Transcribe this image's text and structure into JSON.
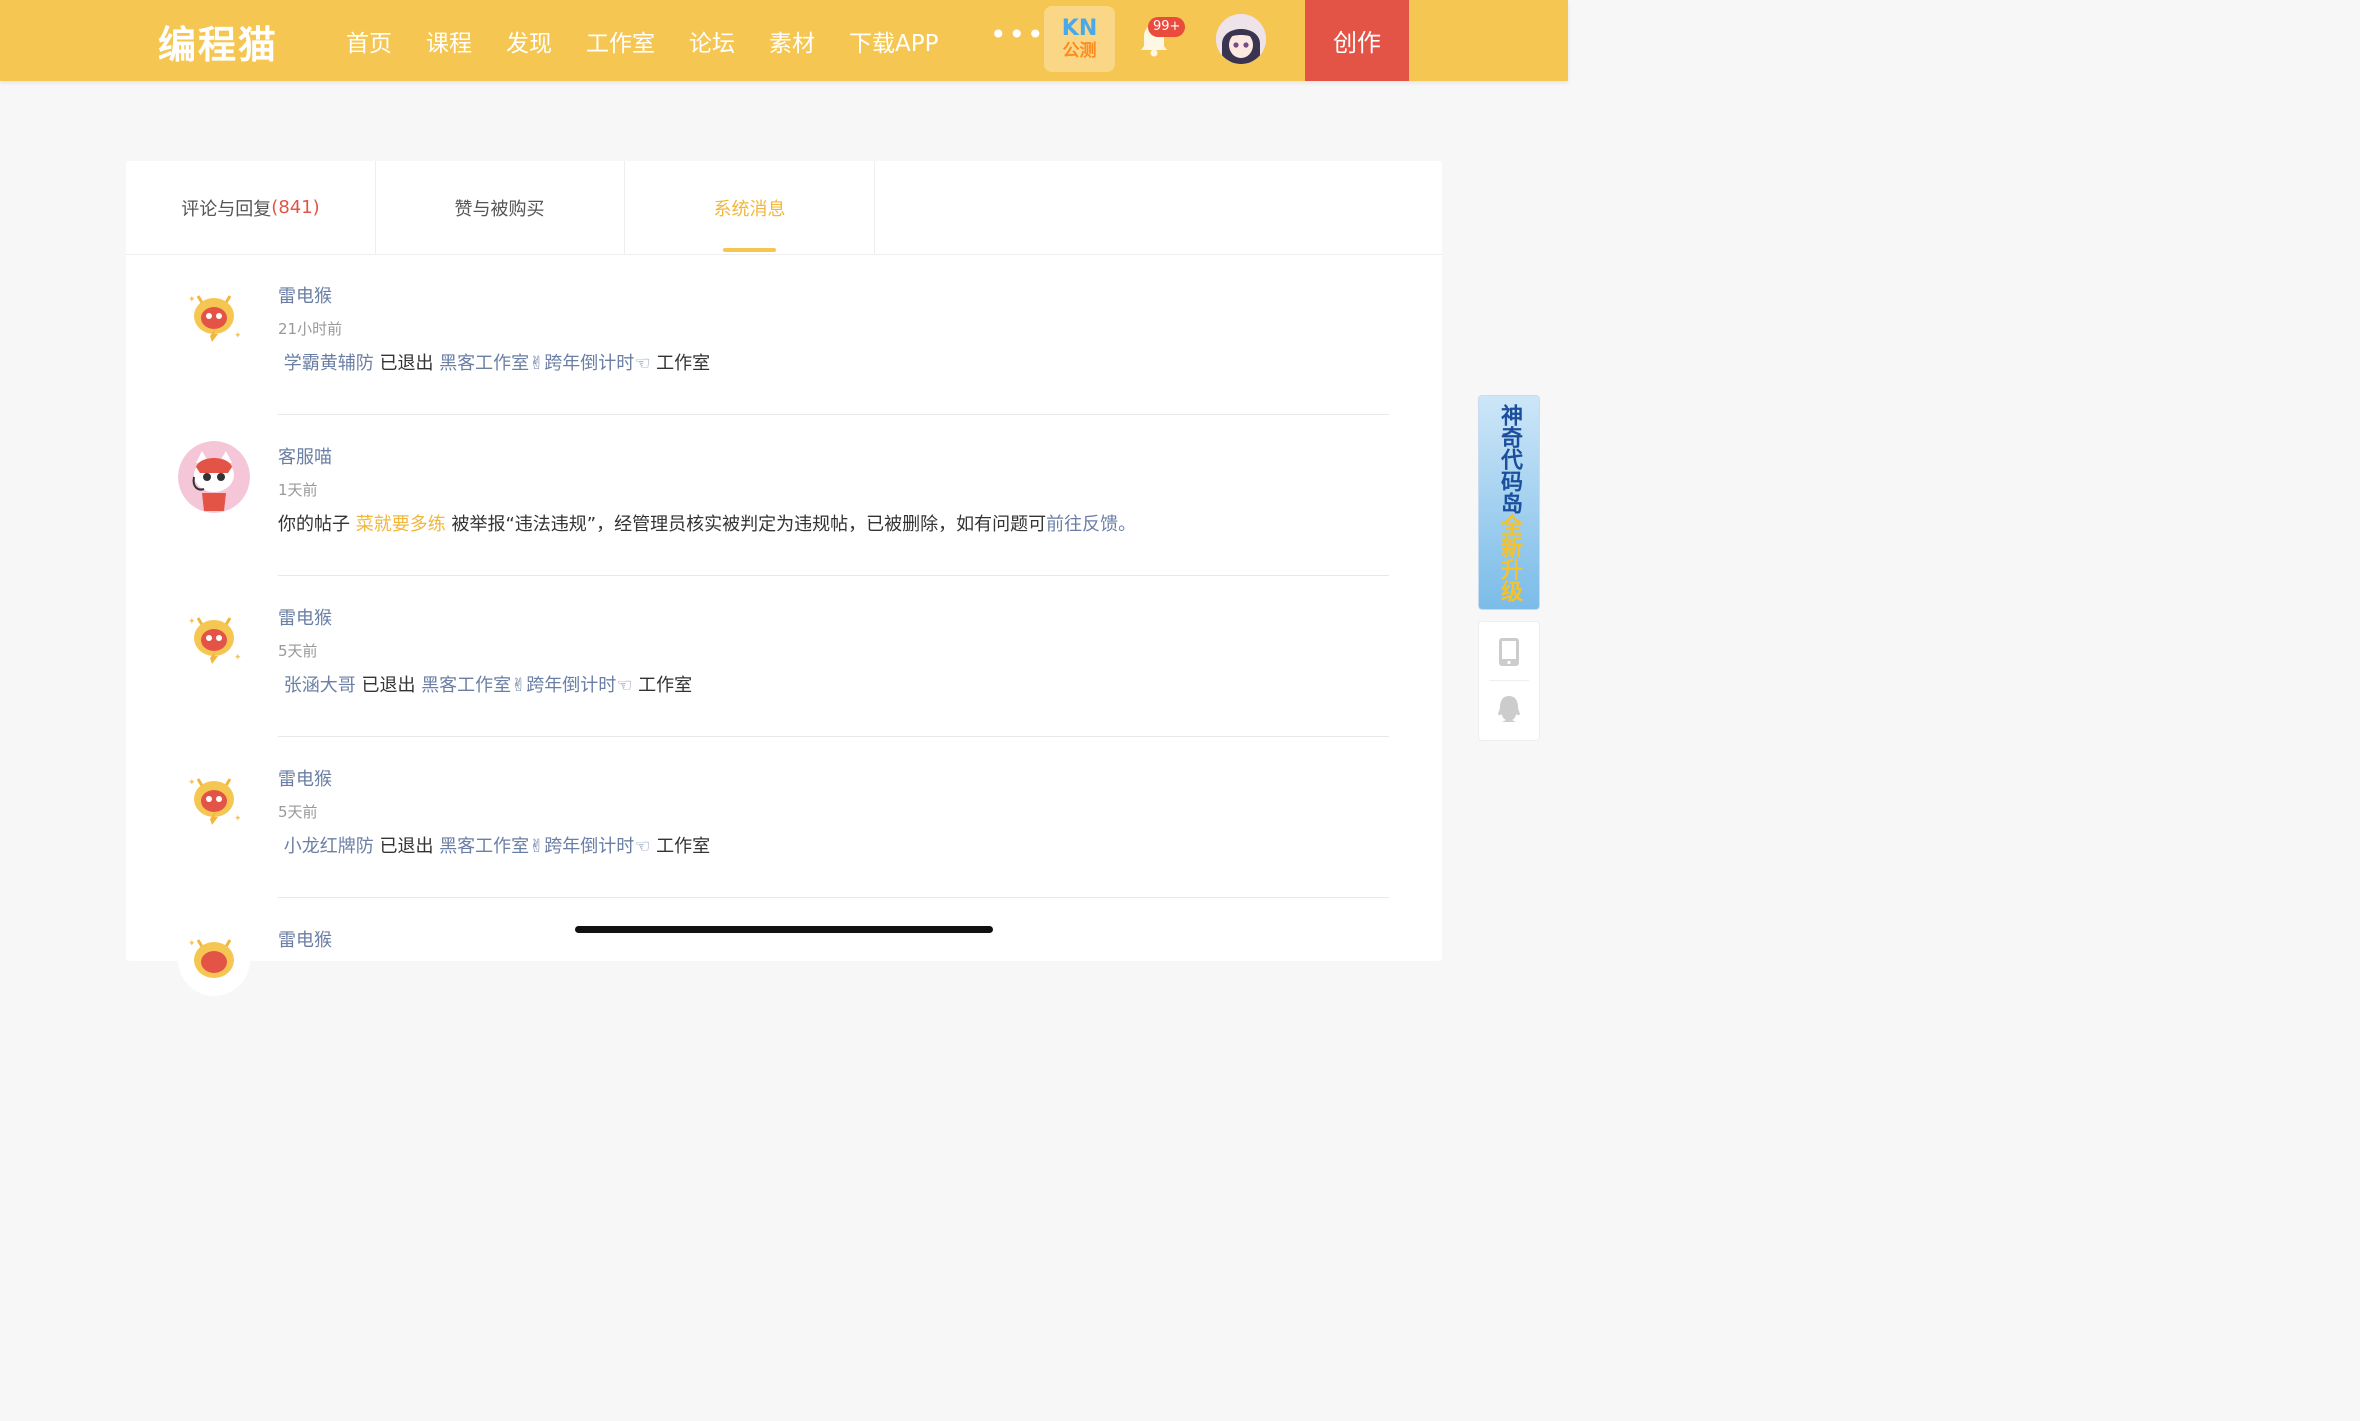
{
  "header": {
    "logo": "编程猫",
    "nav": [
      "首页",
      "课程",
      "发现",
      "工作室",
      "论坛",
      "素材",
      "下载APP"
    ],
    "more": "•••",
    "kn_top": "KN",
    "kn_bottom": "公测",
    "notification_count": "99+",
    "create_label": "创作",
    "accent_color": "#f6c652",
    "create_color": "#e35447"
  },
  "tabs": {
    "comments_label": "评论与回复",
    "comments_count": "(841)",
    "likes_label": "赞与被购买",
    "system_label": "系统消息"
  },
  "messages": [
    {
      "sender": "雷电猴",
      "time": "21小时前",
      "user": "学霸黄辅防",
      "action": " 已退出 ",
      "studio": "黑客工作室✌跨年倒计时☜",
      "suffix": " 工作室"
    },
    {
      "sender": "客服喵",
      "time": "1天前",
      "prefix": "你的帖子 ",
      "post": "菜就要多练",
      "middle": " 被举报“违法违规”，经管理员核实被判定为违规帖，已被删除，如有问题可",
      "link": "前往反馈",
      "end": "。"
    },
    {
      "sender": "雷电猴",
      "time": "5天前",
      "user": "张涵大哥",
      "action": " 已退出 ",
      "studio": "黑客工作室✌跨年倒计时☜",
      "suffix": " 工作室"
    },
    {
      "sender": "雷电猴",
      "time": "5天前",
      "user": "小龙红牌防",
      "action": " 已退出 ",
      "studio": "黑客工作室✌跨年倒计时☜",
      "suffix": " 工作室"
    },
    {
      "sender": "雷电猴"
    }
  ],
  "side": {
    "promo_main": "神奇代码岛",
    "promo_highlight": "全新升级",
    "icons": [
      "tablet-icon",
      "qq-icon"
    ]
  }
}
